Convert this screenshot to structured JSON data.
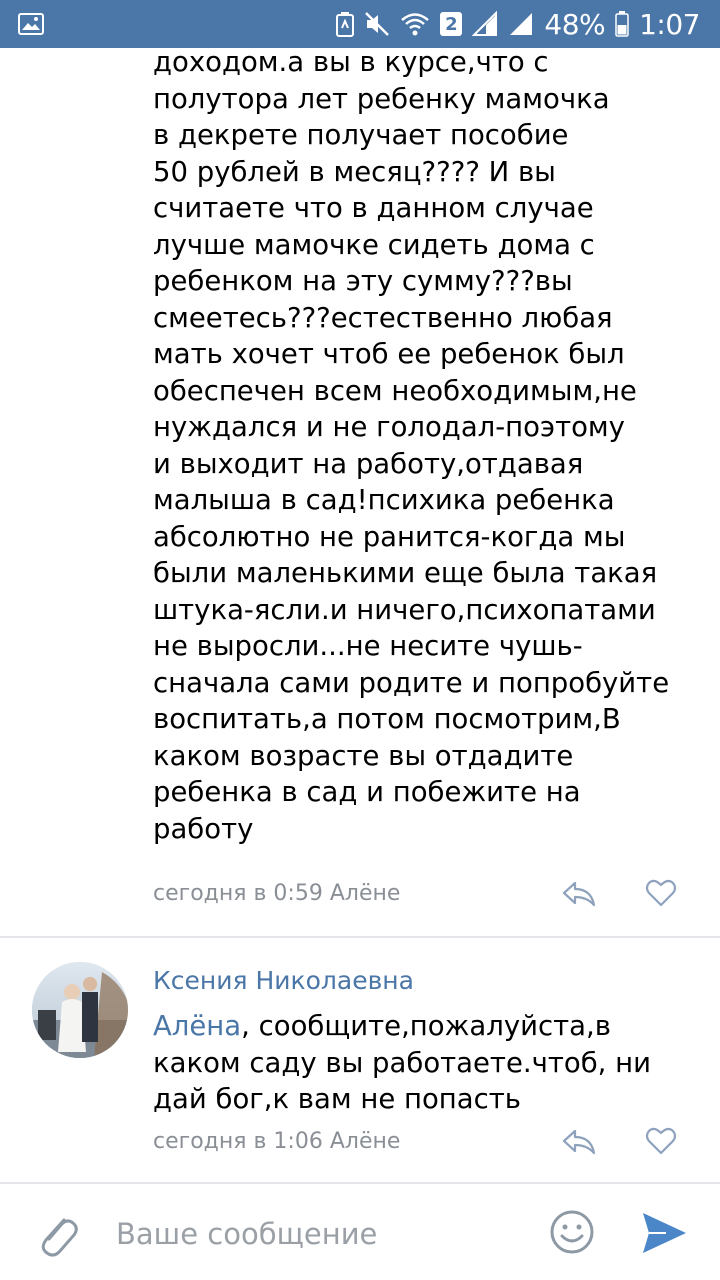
{
  "status_bar": {
    "sim_badge": "2",
    "battery_percent": "48%",
    "time": "1:07",
    "colors": {
      "background": "#4a76a8",
      "foreground": "#ffffff"
    },
    "icons": [
      "gallery-notification-icon",
      "battery-saver-icon",
      "mute-icon",
      "wifi-icon",
      "signal-icon",
      "signal-icon",
      "battery-icon"
    ]
  },
  "comments": [
    {
      "text": "доходом.а вы в курсе,что с\nполутора лет ребенку мамочка\nв декрете получает пособие\n50 рублей в месяц???? И вы\nсчитаете что в данном случае\nлучше мамочке сидеть дома с\nребенком на эту сумму???вы\nсмеетесь???естественно любая\nмать хочет чтоб ее ребенок был\nобеспечен всем необходимым,не\nнуждался и не голодал-поэтому\nи выходит на работу,отдавая\nмалыша в сад!психика ребенка\nабсолютно не ранится-когда мы\nбыли маленькими еще была такая\nштука-ясли.и ничего,психопатами\nне выросли...не несите чушь-\nсначала сами родите и попробуйте\nвоспитать,а потом посмотрим,В\nкаком возрасте вы отдадите\nребенка в сад и побежите на\nработу",
      "meta": "сегодня в 0:59 Алёне"
    },
    {
      "author": "Ксения Николаевна",
      "mention": "Алёна",
      "text": ", сообщите,пожалуйста,в\nкаком саду вы работаете.чтоб, ни\nдай бог,к вам не попасть",
      "meta": "сегодня в 1:06 Алёне"
    }
  ],
  "input": {
    "placeholder": "Ваше сообщение",
    "value": ""
  },
  "colors": {
    "accent": "#4a76a8",
    "meta_text": "#8a8f96",
    "divider": "#e3e5e8",
    "send": "#4a86c8"
  }
}
